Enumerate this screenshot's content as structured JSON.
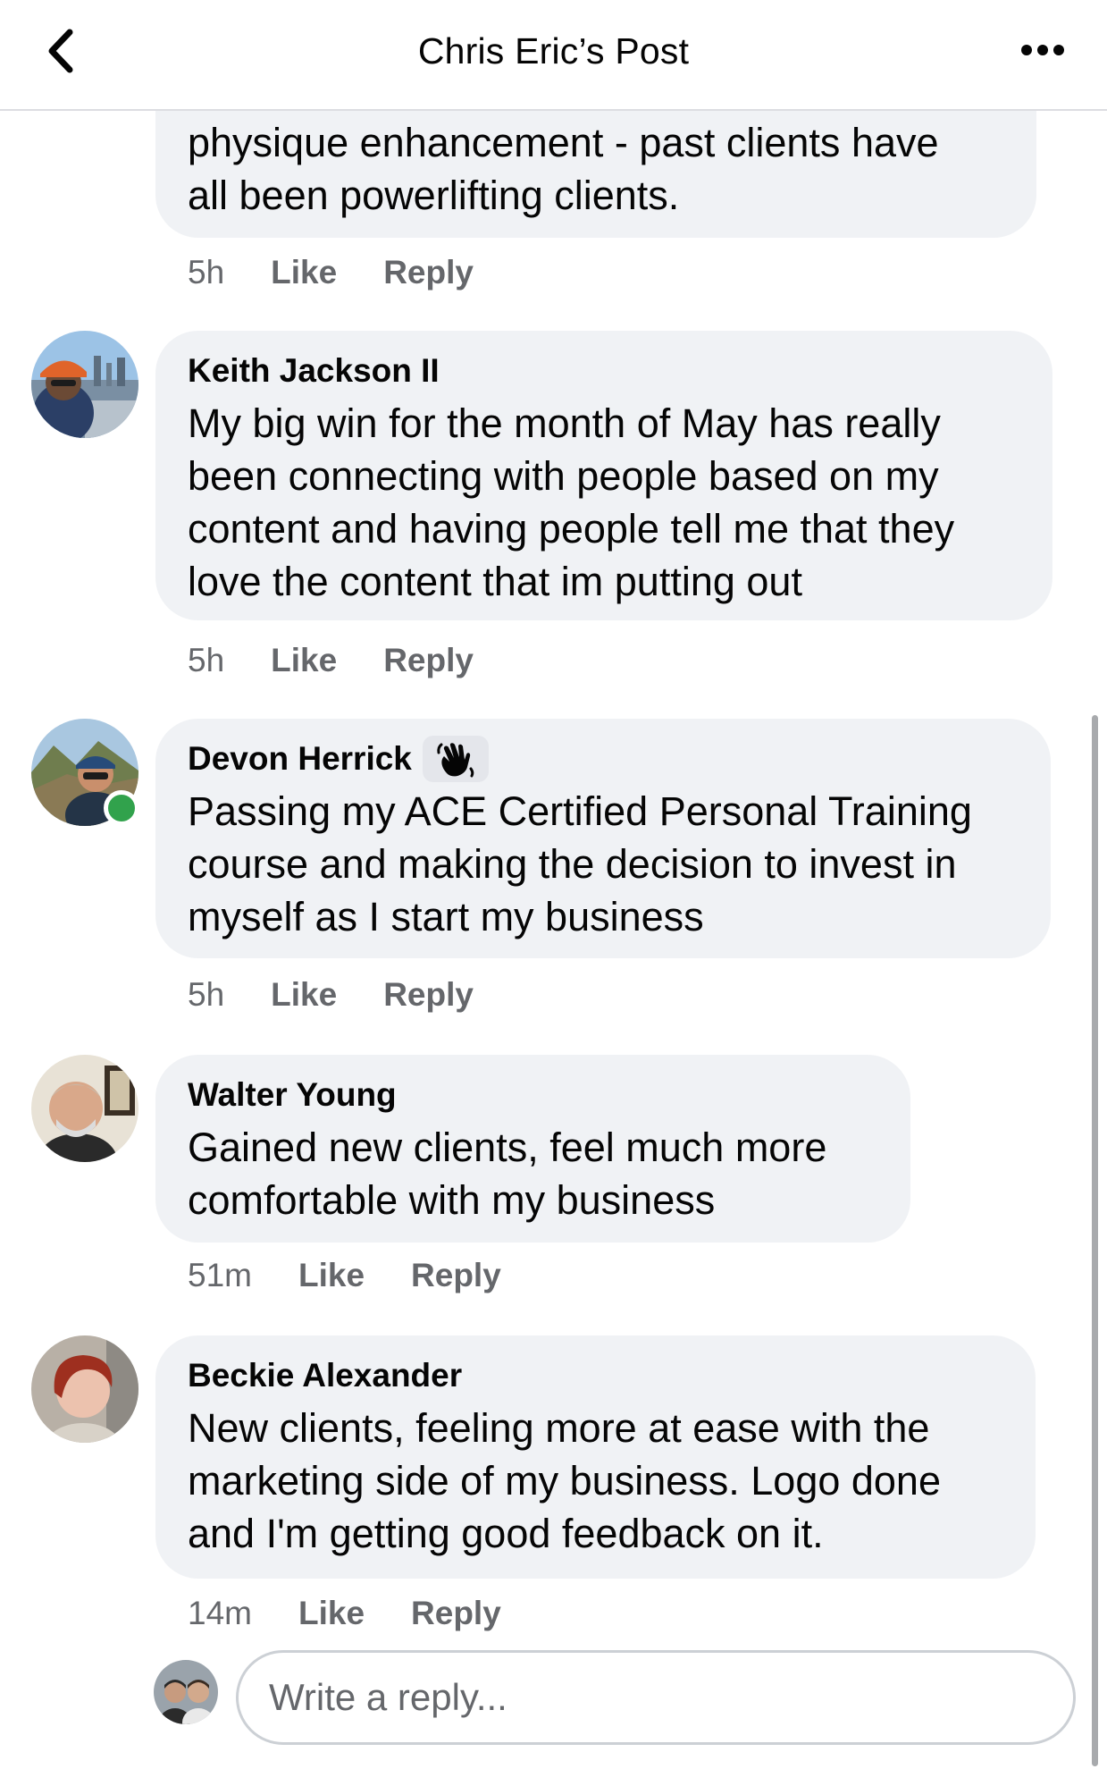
{
  "header": {
    "title": "Chris Eric’s Post",
    "back_icon": "chevron-left-icon",
    "more_icon": "more-horizontal-icon"
  },
  "comments": [
    {
      "author": "",
      "body_lines": [
        "physique enhancement - past clients have",
        "all been powerlifting clients."
      ],
      "time": "5h",
      "like_label": "Like",
      "reply_label": "Reply"
    },
    {
      "author": "Keith Jackson II",
      "body_lines": [
        "My big win for the month of May has really",
        "been connecting with people based on my",
        "content and having people tell me that they",
        "love the content that im putting out"
      ],
      "time": "5h",
      "like_label": "Like",
      "reply_label": "Reply"
    },
    {
      "author": "Devon Herrick",
      "badge_icon": "waving-hand-icon",
      "online": true,
      "body_lines": [
        "Passing my ACE Certified Personal Training",
        "course and making the decision to invest in",
        "myself as I start my business"
      ],
      "time": "5h",
      "like_label": "Like",
      "reply_label": "Reply"
    },
    {
      "author": "Walter Young",
      "body_lines": [
        "Gained new clients, feel much more",
        "comfortable with my business"
      ],
      "time": "51m",
      "like_label": "Like",
      "reply_label": "Reply"
    },
    {
      "author": "Beckie Alexander",
      "body_lines": [
        "New clients, feeling more at ease with the",
        "marketing side of my business. Logo done",
        "and I'm getting good feedback on it."
      ],
      "time": "14m",
      "like_label": "Like",
      "reply_label": "Reply"
    }
  ],
  "composer": {
    "placeholder": "Write a reply..."
  },
  "colors": {
    "bubble_bg": "#f0f2f5",
    "secondary_text": "#65676b",
    "primary_text": "#050505",
    "online_green": "#31a24c"
  }
}
